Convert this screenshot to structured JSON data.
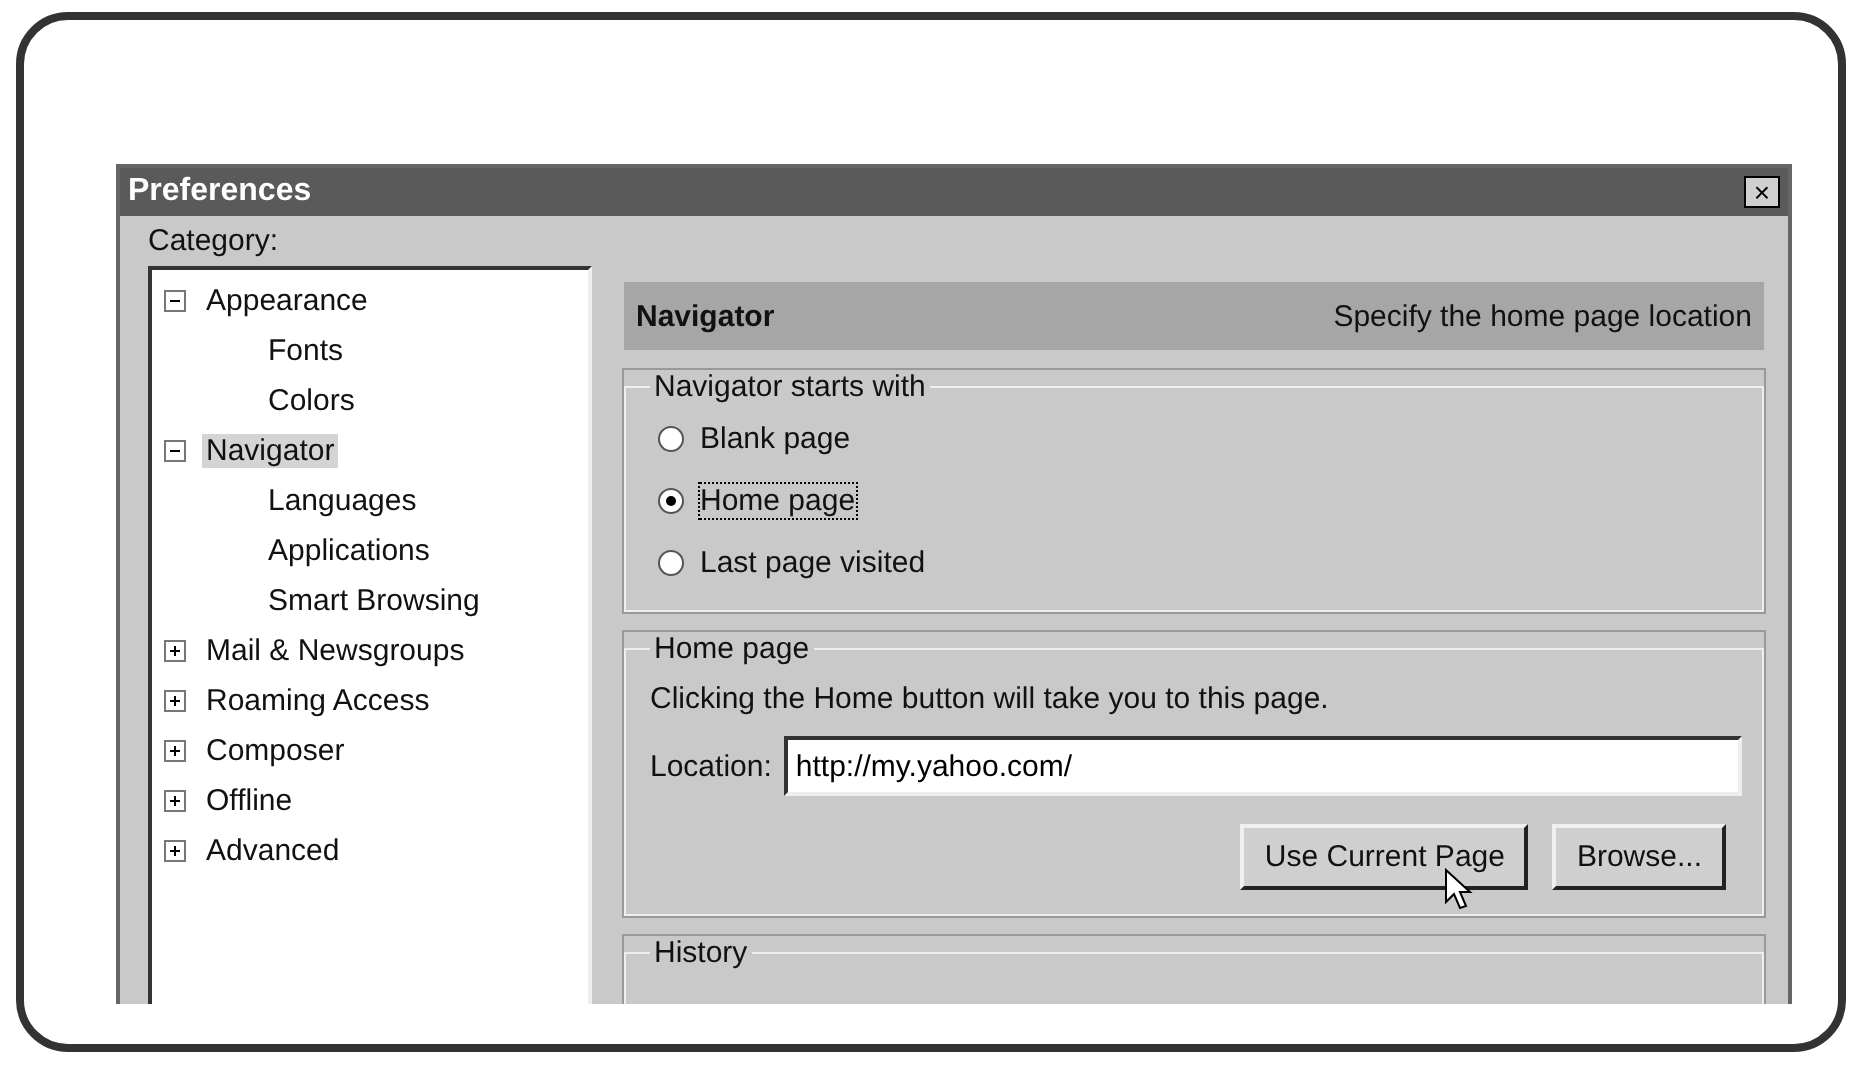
{
  "window": {
    "title": "Preferences",
    "close_button": "×"
  },
  "category_label": "Category:",
  "tree": [
    {
      "label": "Appearance",
      "expanded": true,
      "selected": false,
      "children": [
        {
          "label": "Fonts",
          "selected": false
        },
        {
          "label": "Colors",
          "selected": false
        }
      ]
    },
    {
      "label": "Navigator",
      "expanded": true,
      "selected": true,
      "children": [
        {
          "label": "Languages",
          "selected": false
        },
        {
          "label": "Applications",
          "selected": false
        },
        {
          "label": "Smart Browsing",
          "selected": false
        }
      ]
    },
    {
      "label": "Mail & Newsgroups",
      "expanded": false,
      "selected": false
    },
    {
      "label": "Roaming Access",
      "expanded": false,
      "selected": false
    },
    {
      "label": "Composer",
      "expanded": false,
      "selected": false
    },
    {
      "label": "Offline",
      "expanded": false,
      "selected": false
    },
    {
      "label": "Advanced",
      "expanded": false,
      "selected": false
    }
  ],
  "panel": {
    "title": "Navigator",
    "subtitle": "Specify the home page location",
    "starts_with": {
      "legend": "Navigator starts with",
      "options": [
        {
          "label": "Blank page",
          "selected": false
        },
        {
          "label": "Home page",
          "selected": true
        },
        {
          "label": "Last page visited",
          "selected": false
        }
      ]
    },
    "home_page": {
      "legend": "Home page",
      "description": "Clicking the Home button will take you to this page.",
      "location_label": "Location:",
      "location_value": "http://my.yahoo.com/",
      "buttons": [
        "Use Current Page",
        "Browse..."
      ]
    },
    "history": {
      "legend": "History"
    }
  }
}
